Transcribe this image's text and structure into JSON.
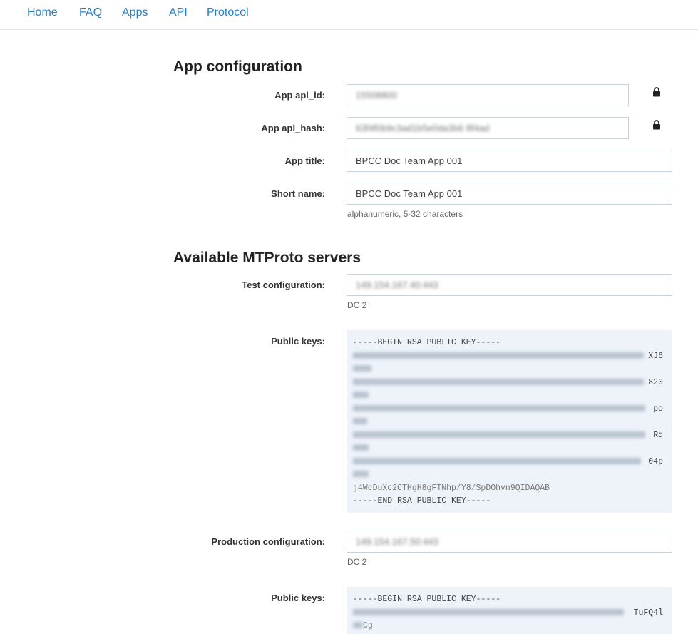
{
  "nav": {
    "items": [
      {
        "label": "Home"
      },
      {
        "label": "FAQ"
      },
      {
        "label": "Apps"
      },
      {
        "label": "API"
      },
      {
        "label": "Protocol"
      }
    ]
  },
  "app_config": {
    "title": "App configuration",
    "api_id": {
      "label": "App api_id:",
      "value": "15508800"
    },
    "api_hash": {
      "label": "App api_hash:",
      "value": "63f4f0b9c3ad1b5e0da3b6 8f4ad"
    },
    "app_title": {
      "label": "App title:",
      "value": "BPCC Doc Team App 001"
    },
    "short_name": {
      "label": "Short name:",
      "value": "BPCC Doc Team App 001",
      "hint": "alphanumeric, 5-32 characters"
    }
  },
  "servers": {
    "title": "Available MTProto servers",
    "test": {
      "label": "Test configuration:",
      "value": "149.154.167.40:443",
      "dc": "DC 2",
      "keys_label": "Public keys:",
      "key_begin": "-----BEGIN RSA PUBLIC KEY-----",
      "key_tails": [
        "XJ6",
        "820",
        "po",
        "Rq",
        "04p"
      ],
      "key_last": "j4WcDuXc2CTHgH8gFTNhp/Y8/SpDOhvn9QIDAQAB",
      "key_end": "-----END RSA PUBLIC KEY-----"
    },
    "production": {
      "label": "Production configuration:",
      "value": "149.154.167.50:443",
      "dc": "DC 2",
      "keys_label": "Public keys:",
      "key_begin": "-----BEGIN RSA PUBLIC KEY-----",
      "key_tails": [
        "TuFQ4l"
      ],
      "key_second": "Cg"
    }
  },
  "icons": {
    "lock": "lock-icon"
  },
  "colors": {
    "link": "#2481cc",
    "keybox_bg": "#eef3fa"
  }
}
